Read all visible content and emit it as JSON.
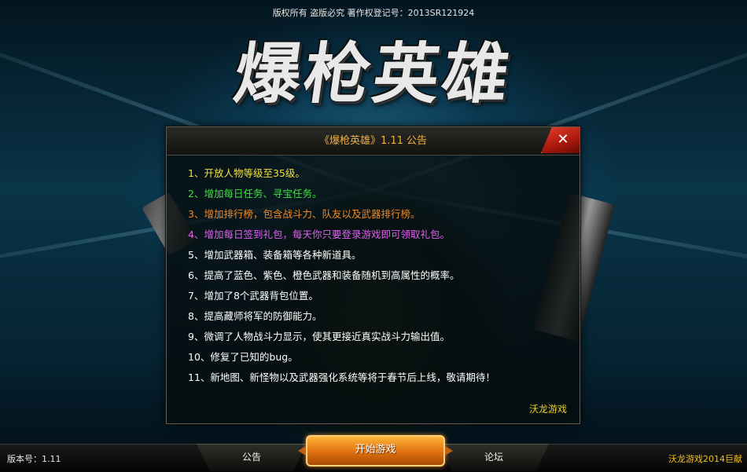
{
  "header": {
    "copyright": "版权所有 盗版必究 著作权登记号：2013SR121924",
    "logo_text": "爆枪英雄"
  },
  "dialog": {
    "title": "《爆枪英雄》1.11 公告",
    "close_icon": "close-icon",
    "items": [
      {
        "text": "1、开放人物等级至35级。",
        "color": "#f0e040"
      },
      {
        "text": "2、增加每日任务、寻宝任务。",
        "color": "#40e040"
      },
      {
        "text": "3、增加排行榜，包含战斗力、队友以及武器排行榜。",
        "color": "#f08a20"
      },
      {
        "text": "4、增加每日签到礼包，每天你只要登录游戏即可领取礼包。",
        "color": "#e060f0"
      },
      {
        "text": "5、增加武器箱、装备箱等各种新道具。",
        "color": "#ffffff"
      },
      {
        "text": "6、提高了蓝色、紫色、橙色武器和装备随机到高属性的概率。",
        "color": "#ffffff"
      },
      {
        "text": "7、增加了8个武器背包位置。",
        "color": "#ffffff"
      },
      {
        "text": "8、提高藏师将军的防御能力。",
        "color": "#ffffff"
      },
      {
        "text": "9、微调了人物战斗力显示，使其更接近真实战斗力输出值。",
        "color": "#ffffff"
      },
      {
        "text": "10、修复了已知的bug。",
        "color": "#ffffff"
      },
      {
        "text": "11、新地图、新怪物以及武器强化系统等将于春节后上线，敬请期待！",
        "color": "#ffffff"
      }
    ],
    "signature": "沃龙游戏"
  },
  "footer": {
    "version": "版本号：1.11",
    "tab_notice": "公告",
    "start_button": "开始游戏",
    "tab_forum": "论坛",
    "credit": "沃龙游戏2014巨献"
  }
}
